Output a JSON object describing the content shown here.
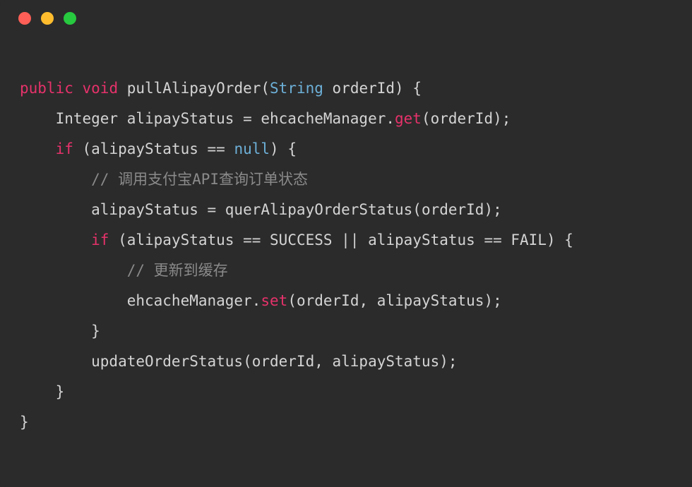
{
  "titlebar": {
    "dots": [
      "red",
      "yellow",
      "green"
    ]
  },
  "code": {
    "l1": {
      "kw1": "public",
      "kw2": "void",
      "fn": " pullAlipayOrder(",
      "type": "String",
      "rest": " orderId) {"
    },
    "l2": {
      "txt1": "    Integer alipayStatus = ehcacheManager.",
      "m": "get",
      "txt2": "(orderId);"
    },
    "l3": {
      "txt1": "    ",
      "kw": "if",
      "txt2": " (alipayStatus == ",
      "null": "null",
      "txt3": ") {"
    },
    "l4": {
      "indent": "        ",
      "comment": "// 调用支付宝API查询订单状态"
    },
    "l5": "        alipayStatus = querAlipayOrderStatus(orderId);",
    "l6": {
      "txt1": "        ",
      "kw": "if",
      "txt2": " (alipayStatus == SUCCESS || alipayStatus == FAIL) {"
    },
    "l7": {
      "indent": "            ",
      "comment": "// 更新到缓存"
    },
    "l8": {
      "txt1": "            ehcacheManager.",
      "m": "set",
      "txt2": "(orderId, alipayStatus);"
    },
    "l9": "        }",
    "l10": "        updateOrderStatus(orderId, alipayStatus);",
    "l11": "    }",
    "l12": "}"
  }
}
